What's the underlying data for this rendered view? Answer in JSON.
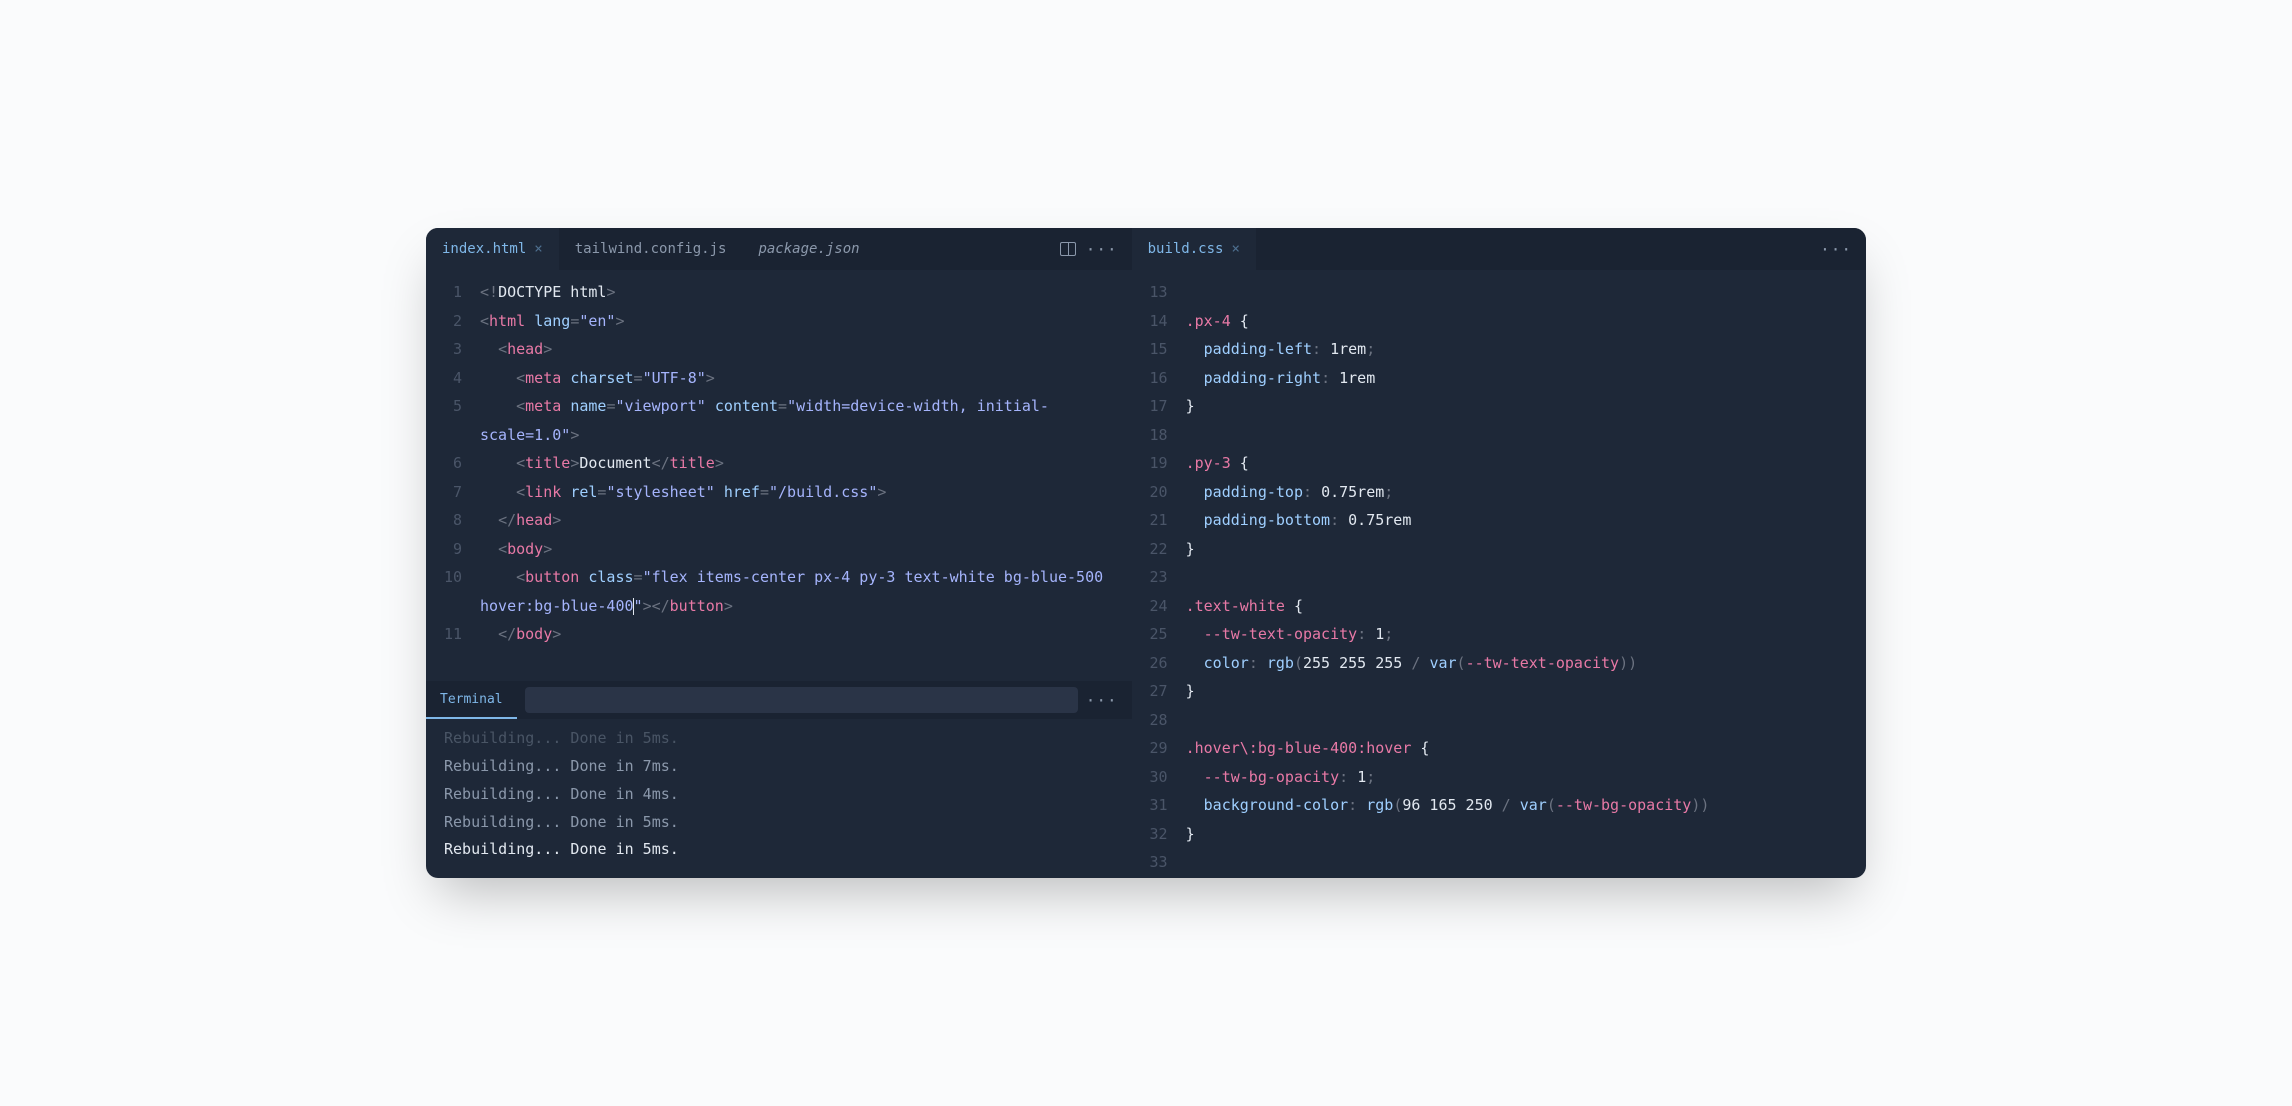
{
  "leftPane": {
    "tabs": [
      {
        "label": "index.html",
        "active": true,
        "closable": true,
        "italic": false
      },
      {
        "label": "tailwind.config.js",
        "active": false,
        "closable": false,
        "italic": false
      },
      {
        "label": "package.json",
        "active": false,
        "closable": false,
        "italic": true
      }
    ],
    "code": [
      {
        "n": "1",
        "tokens": [
          [
            "punct",
            "<!"
          ],
          [
            "white",
            "DOCTYPE html"
          ],
          [
            "punct",
            ">"
          ]
        ]
      },
      {
        "n": "2",
        "tokens": [
          [
            "punct",
            "<"
          ],
          [
            "tag",
            "html"
          ],
          [
            "white",
            " "
          ],
          [
            "attr",
            "lang"
          ],
          [
            "punct",
            "="
          ],
          [
            "str",
            "\"en\""
          ],
          [
            "punct",
            ">"
          ]
        ]
      },
      {
        "n": "3",
        "indent": "  ",
        "tokens": [
          [
            "punct",
            "<"
          ],
          [
            "tag",
            "head"
          ],
          [
            "punct",
            ">"
          ]
        ]
      },
      {
        "n": "4",
        "indent": "    ",
        "tokens": [
          [
            "punct",
            "<"
          ],
          [
            "tag",
            "meta"
          ],
          [
            "white",
            " "
          ],
          [
            "attr",
            "charset"
          ],
          [
            "punct",
            "="
          ],
          [
            "str",
            "\"UTF-8\""
          ],
          [
            "punct",
            ">"
          ]
        ]
      },
      {
        "n": "5",
        "indent": "    ",
        "tokens": [
          [
            "punct",
            "<"
          ],
          [
            "tag",
            "meta"
          ],
          [
            "white",
            " "
          ],
          [
            "attr",
            "name"
          ],
          [
            "punct",
            "="
          ],
          [
            "str",
            "\"viewport\""
          ],
          [
            "white",
            " "
          ],
          [
            "attr",
            "content"
          ],
          [
            "punct",
            "="
          ],
          [
            "str",
            "\"width=device-width, initial-scale=1.0\""
          ],
          [
            "punct",
            ">"
          ]
        ]
      },
      {
        "n": "6",
        "indent": "    ",
        "tokens": [
          [
            "punct",
            "<"
          ],
          [
            "tag",
            "title"
          ],
          [
            "punct",
            ">"
          ],
          [
            "white",
            "Document"
          ],
          [
            "punct",
            "</"
          ],
          [
            "tag",
            "title"
          ],
          [
            "punct",
            ">"
          ]
        ]
      },
      {
        "n": "7",
        "indent": "    ",
        "tokens": [
          [
            "punct",
            "<"
          ],
          [
            "tag",
            "link"
          ],
          [
            "white",
            " "
          ],
          [
            "attr",
            "rel"
          ],
          [
            "punct",
            "="
          ],
          [
            "str",
            "\"stylesheet\""
          ],
          [
            "white",
            " "
          ],
          [
            "attr",
            "href"
          ],
          [
            "punct",
            "="
          ],
          [
            "str",
            "\"/build.css\""
          ],
          [
            "punct",
            ">"
          ]
        ]
      },
      {
        "n": "8",
        "indent": "  ",
        "tokens": [
          [
            "punct",
            "</"
          ],
          [
            "tag",
            "head"
          ],
          [
            "punct",
            ">"
          ]
        ]
      },
      {
        "n": "9",
        "indent": "  ",
        "tokens": [
          [
            "punct",
            "<"
          ],
          [
            "tag",
            "body"
          ],
          [
            "punct",
            ">"
          ]
        ]
      },
      {
        "n": "10",
        "indent": "    ",
        "tokens": [
          [
            "punct",
            "<"
          ],
          [
            "tag",
            "button"
          ],
          [
            "white",
            " "
          ],
          [
            "attr",
            "class"
          ],
          [
            "punct",
            "="
          ],
          [
            "str",
            "\"flex items-center px-4 py-3 text-white bg-blue-500 hover:bg-blue-400"
          ],
          [
            "cursor",
            ""
          ],
          [
            "str",
            "\""
          ],
          [
            "punct",
            "></"
          ],
          [
            "tag",
            "button"
          ],
          [
            "punct",
            ">"
          ]
        ]
      },
      {
        "n": "11",
        "indent": "  ",
        "tokens": [
          [
            "punct",
            "</"
          ],
          [
            "tag",
            "body"
          ],
          [
            "punct",
            ">"
          ]
        ]
      }
    ]
  },
  "rightPane": {
    "tabs": [
      {
        "label": "build.css",
        "active": true,
        "closable": true,
        "italic": false
      }
    ],
    "code": [
      {
        "n": "13",
        "tokens": []
      },
      {
        "n": "14",
        "tokens": [
          [
            "sel",
            ".px-4"
          ],
          [
            "white",
            " {"
          ]
        ]
      },
      {
        "n": "15",
        "indent": "  ",
        "tokens": [
          [
            "prop",
            "padding-left"
          ],
          [
            "punct",
            ": "
          ],
          [
            "num",
            "1rem"
          ],
          [
            "punct",
            ";"
          ]
        ]
      },
      {
        "n": "16",
        "indent": "  ",
        "tokens": [
          [
            "prop",
            "padding-right"
          ],
          [
            "punct",
            ": "
          ],
          [
            "num",
            "1rem"
          ]
        ]
      },
      {
        "n": "17",
        "tokens": [
          [
            "white",
            "}"
          ]
        ]
      },
      {
        "n": "18",
        "tokens": []
      },
      {
        "n": "19",
        "tokens": [
          [
            "sel",
            ".py-3"
          ],
          [
            "white",
            " {"
          ]
        ]
      },
      {
        "n": "20",
        "indent": "  ",
        "tokens": [
          [
            "prop",
            "padding-top"
          ],
          [
            "punct",
            ": "
          ],
          [
            "num",
            "0.75rem"
          ],
          [
            "punct",
            ";"
          ]
        ]
      },
      {
        "n": "21",
        "indent": "  ",
        "tokens": [
          [
            "prop",
            "padding-bottom"
          ],
          [
            "punct",
            ": "
          ],
          [
            "num",
            "0.75rem"
          ]
        ]
      },
      {
        "n": "22",
        "tokens": [
          [
            "white",
            "}"
          ]
        ]
      },
      {
        "n": "23",
        "tokens": []
      },
      {
        "n": "24",
        "tokens": [
          [
            "sel",
            ".text-white"
          ],
          [
            "white",
            " {"
          ]
        ]
      },
      {
        "n": "25",
        "indent": "  ",
        "tokens": [
          [
            "var",
            "--tw-text-opacity"
          ],
          [
            "punct",
            ": "
          ],
          [
            "num",
            "1"
          ],
          [
            "punct",
            ";"
          ]
        ]
      },
      {
        "n": "26",
        "indent": "  ",
        "tokens": [
          [
            "prop",
            "color"
          ],
          [
            "punct",
            ": "
          ],
          [
            "fn",
            "rgb"
          ],
          [
            "punct",
            "("
          ],
          [
            "num",
            "255 255 255"
          ],
          [
            "punct",
            " / "
          ],
          [
            "fn",
            "var"
          ],
          [
            "punct",
            "("
          ],
          [
            "var",
            "--tw-text-opacity"
          ],
          [
            "punct",
            "))"
          ]
        ]
      },
      {
        "n": "27",
        "tokens": [
          [
            "white",
            "}"
          ]
        ]
      },
      {
        "n": "28",
        "tokens": []
      },
      {
        "n": "29",
        "tokens": [
          [
            "sel",
            ".hover\\:bg-blue-400"
          ],
          [
            "kw",
            ":hover"
          ],
          [
            "white",
            " {"
          ]
        ]
      },
      {
        "n": "30",
        "indent": "  ",
        "tokens": [
          [
            "var",
            "--tw-bg-opacity"
          ],
          [
            "punct",
            ": "
          ],
          [
            "num",
            "1"
          ],
          [
            "punct",
            ";"
          ]
        ]
      },
      {
        "n": "31",
        "indent": "  ",
        "tokens": [
          [
            "prop",
            "background-color"
          ],
          [
            "punct",
            ": "
          ],
          [
            "fn",
            "rgb"
          ],
          [
            "punct",
            "("
          ],
          [
            "num",
            "96 165 250"
          ],
          [
            "punct",
            " / "
          ],
          [
            "fn",
            "var"
          ],
          [
            "punct",
            "("
          ],
          [
            "var",
            "--tw-bg-opacity"
          ],
          [
            "punct",
            "))"
          ]
        ]
      },
      {
        "n": "32",
        "tokens": [
          [
            "white",
            "}"
          ]
        ]
      },
      {
        "n": "33",
        "tokens": []
      }
    ]
  },
  "terminal": {
    "label": "Terminal",
    "lines": [
      {
        "text": "Rebuilding... Done in 5ms.",
        "cls": "cut"
      },
      {
        "text": "Rebuilding... Done in 7ms.",
        "cls": ""
      },
      {
        "text": "Rebuilding... Done in 4ms.",
        "cls": ""
      },
      {
        "text": "Rebuilding... Done in 5ms.",
        "cls": ""
      },
      {
        "text": "Rebuilding... Done in 5ms.",
        "cls": "recent"
      }
    ]
  },
  "icons": {
    "ellipsis": "···"
  }
}
